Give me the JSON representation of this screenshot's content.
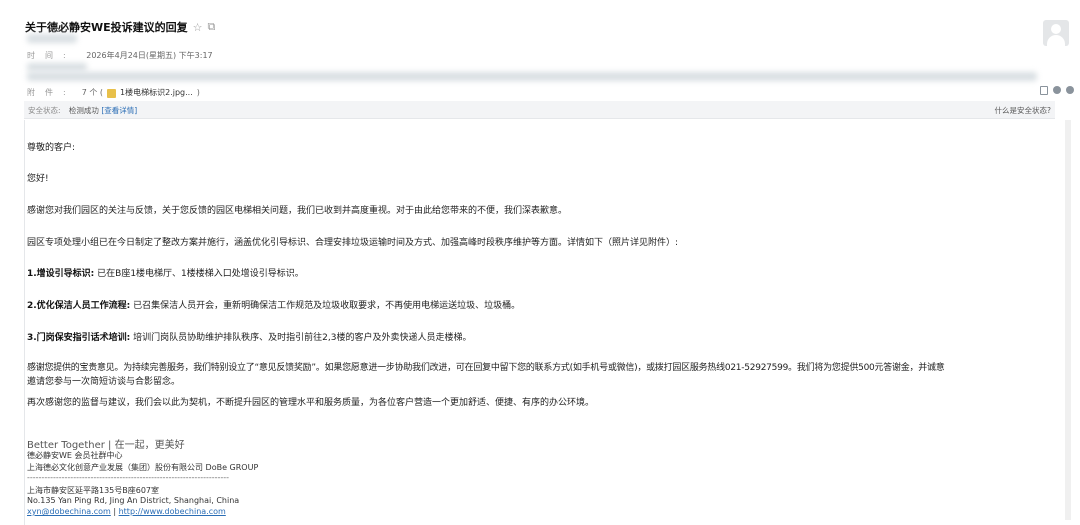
{
  "mail": {
    "subject": "关于德必静安WE投诉建议的回复",
    "star_icon": "☆",
    "popout_icon": "⧉",
    "time_label": "时间:",
    "time_value": "2026年4月24日(星期五) 下午3:17",
    "attachment_label": "附件:",
    "attachment_count": "7 个 (",
    "attachment_name": "1楼电梯标识2.jpg...",
    "attachment_close": ")",
    "security": {
      "label": "安全状态:",
      "status": "检测成功",
      "details_link": "[查看详情]",
      "help": "什么是安全状态?"
    }
  },
  "body": {
    "greeting": "尊敬的客户:",
    "hello": "您好!",
    "p1": "感谢您对我们园区的关注与反馈，关于您反馈的园区电梯相关问题，我们已收到并高度重视。对于由此给您带来的不便，我们深表歉意。",
    "p2": "园区专项处理小组已在今日制定了整改方案并施行，涵盖优化引导标识、合理安排垃圾运输时间及方式、加强高峰时段秩序维护等方面。详情如下（照片详见附件）:",
    "item1_title": "1.增设引导标识:",
    "item1_text": "已在B座1楼电梯厅、1楼楼梯入口处增设引导标识。",
    "item2_title": "2.优化保洁人员工作流程:",
    "item2_text": "已召集保洁人员开会，重新明确保洁工作规范及垃圾收取要求，不再使用电梯运送垃圾、垃圾桶。",
    "item3_title": "3.门岗保安指引话术培训:",
    "item3_text": "培训门岗队员协助维护排队秩序、及时指引前往2,3楼的客户及外卖快递人员走楼梯。",
    "p3_line1": "感谢您提供的宝贵意见。为持续完善服务，我们特别设立了“意见反馈奖励”。如果您愿意进一步协助我们改进，可在回复中留下您的联系方式(如手机号或微信)，或拨打园区服务热线021-52927599。我们将为您提供500元答谢金，并诚意",
    "p3_line2": "邀请您参与一次简短访谈与合影留念。",
    "p4": "再次感谢您的监督与建议，我们会以此为契机，不断提升园区的管理水平和服务质量，为各位客户营造一个更加舒适、便捷、有序的办公环境。"
  },
  "signature": {
    "tagline": "Better Together | 在一起，更美好",
    "org1": "德必静安WE 会员社群中心",
    "org2": "上海德必文化创意产业发展（集团）股份有限公司  DoBe GROUP",
    "divider": "----------------------------------------------------------------------",
    "addr_cn": "上海市静安区延平路135号B座607室",
    "addr_en": "No.135 Yan Ping Rd, Jing An District, Shanghai, China",
    "email": "xyn@dobechina.com",
    "sep": " | ",
    "website": "http://www.dobechina.com"
  }
}
